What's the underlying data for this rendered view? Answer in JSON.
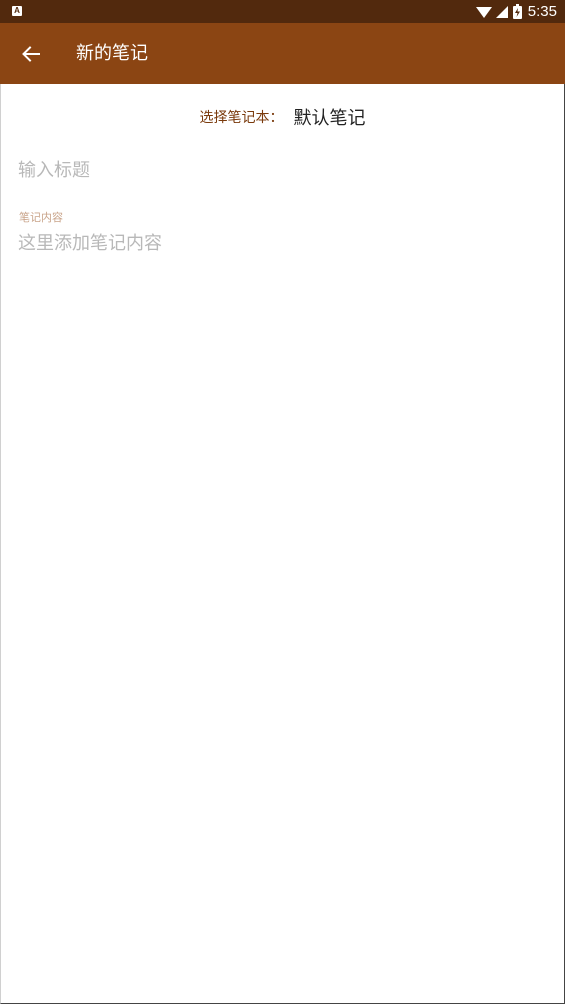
{
  "status_bar": {
    "time": "5:35",
    "app_icon_letter": "A",
    "icons": [
      "wifi-icon",
      "cell-signal-icon",
      "battery-icon"
    ]
  },
  "app_bar": {
    "title": "新的笔记",
    "back_icon": "arrow-back-icon"
  },
  "notebook_selector": {
    "label": "选择笔记本：",
    "value": "默认笔记"
  },
  "title_field": {
    "placeholder": "输入标题",
    "value": ""
  },
  "content_field": {
    "floating_label": "笔记内容",
    "placeholder": "这里添加笔记内容",
    "value": ""
  },
  "colors": {
    "status_bar": "#52290d",
    "app_bar": "#8b4513",
    "accent_label": "#7a3a0c",
    "hint": "#b8b8b8",
    "floating_label": "#c9a48a"
  }
}
